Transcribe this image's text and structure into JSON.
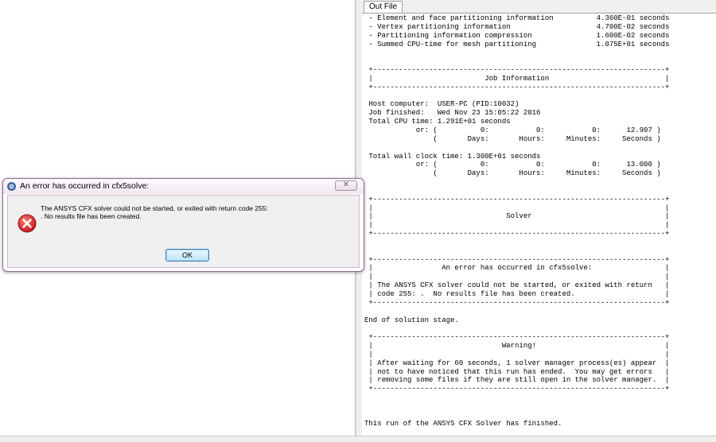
{
  "output_panel": {
    "tab_label": "Out File",
    "lines": [
      " - Element and face partitioning information          4.360E-01 seconds",
      " - Vertex partitioning information                    4.700E-02 seconds",
      " - Partitioning information compression               1.600E-02 seconds",
      " - Summed CPU-time for mesh partitioning              1.075E+01 seconds",
      "",
      "",
      " +--------------------------------------------------------------------+",
      " |                          Job Information                           |",
      " +--------------------------------------------------------------------+",
      "",
      " Host computer:  USER-PC (PID:10032)",
      " Job finished:   Wed Nov 23 15:05:22 2016",
      " Total CPU time: 1.291E+01 seconds",
      "            or: (          0:           0:           0:      12.907 )",
      "                (       Days:       Hours:     Minutes:     Seconds )",
      "",
      " Total wall clock time: 1.300E+01 seconds",
      "            or: (          0:           0:           0:      13.000 )",
      "                (       Days:       Hours:     Minutes:     Seconds )",
      "",
      "",
      " +--------------------------------------------------------------------+",
      " |                                                                    |",
      " |                               Solver                               |",
      " |                                                                    |",
      " +--------------------------------------------------------------------+",
      "",
      "",
      " +--------------------------------------------------------------------+",
      " |                An error has occurred in cfx5solve:                 |",
      " |                                                                    |",
      " | The ANSYS CFX solver could not be started, or exited with return   |",
      " | code 255: .  No results file has been created.                     |",
      " +--------------------------------------------------------------------+",
      "",
      "End of solution stage.",
      "",
      " +--------------------------------------------------------------------+",
      " |                              Warning!                              |",
      " |                                                                    |",
      " | After waiting for 60 seconds, 1 solver manager process(es) appear  |",
      " | not to have noticed that this run has ended.  You may get errors   |",
      " | removing some files if they are still open in the solver manager.  |",
      " +--------------------------------------------------------------------+",
      "",
      "",
      "",
      "This run of the ANSYS CFX Solver has finished."
    ]
  },
  "dialog": {
    "title": "An error has occurred in cfx5solve:",
    "message_line1": "The ANSYS CFX solver could not be started, or exited with return code 255:",
    ".": "",
    "message_line2": ".  No results file has been created.",
    "ok_label": "OK",
    "close_glyph": "✕",
    "title_icon": "cfx-app-icon",
    "message_icon": "error-icon"
  },
  "colors": {
    "error_red": "#c8191f",
    "ok_button_border": "#3c7fb1",
    "dialog_frame": "#8a6a8a"
  }
}
